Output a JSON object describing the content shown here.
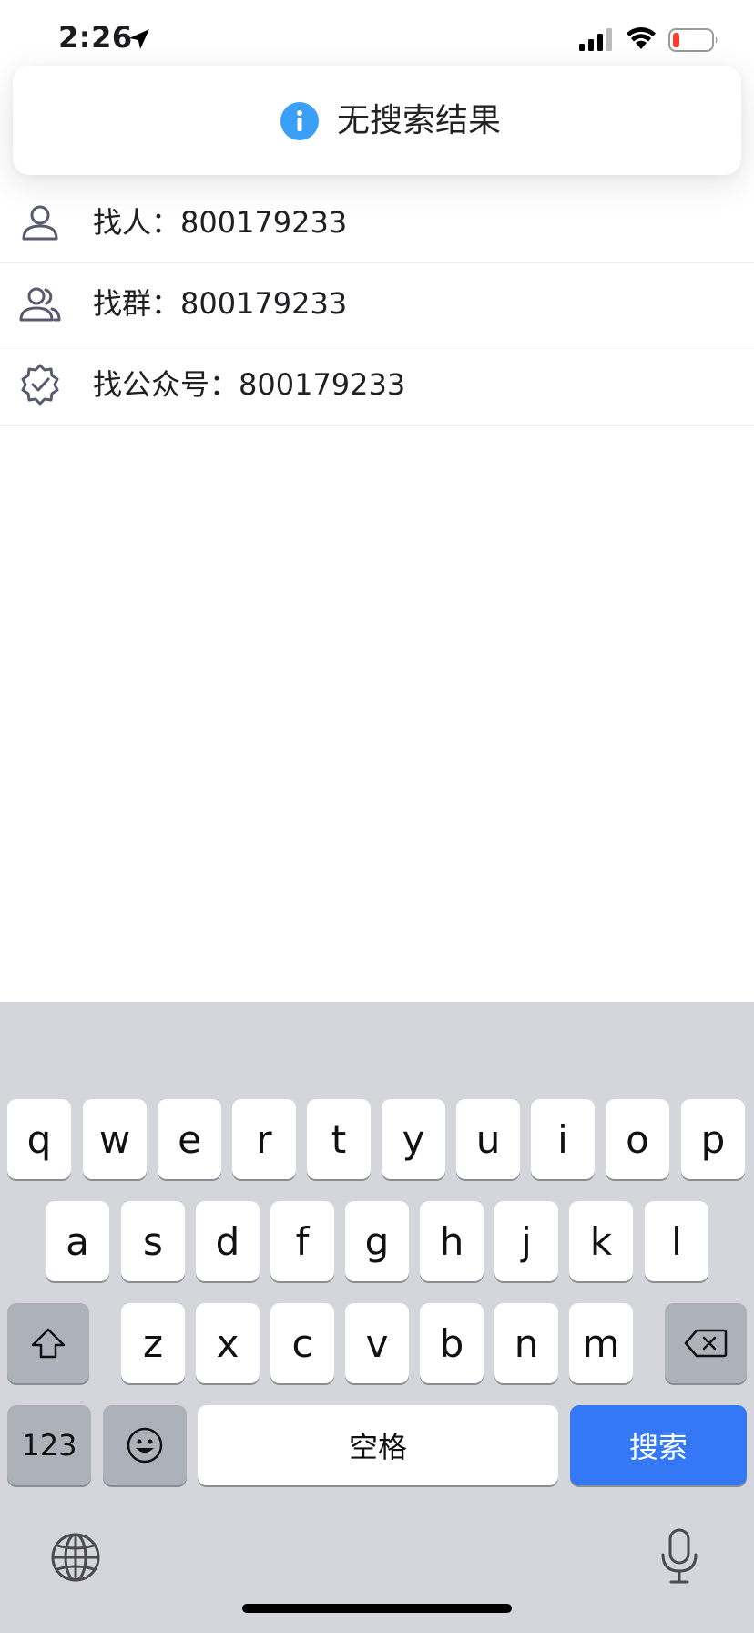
{
  "status_bar": {
    "time": "2:26"
  },
  "toast": {
    "message": "无搜索结果",
    "icon": "info-icon",
    "accent_color": "#3aa0f7"
  },
  "results": [
    {
      "icon": "user-icon",
      "label": "找人：800179233"
    },
    {
      "icon": "group-icon",
      "label": "找群：800179233"
    },
    {
      "icon": "verified-badge-icon",
      "label": "找公众号：800179233"
    }
  ],
  "keyboard": {
    "row1": [
      "q",
      "w",
      "e",
      "r",
      "t",
      "y",
      "u",
      "i",
      "o",
      "p"
    ],
    "row2": [
      "a",
      "s",
      "d",
      "f",
      "g",
      "h",
      "j",
      "k",
      "l"
    ],
    "row3": [
      "z",
      "x",
      "c",
      "v",
      "b",
      "n",
      "m"
    ],
    "numbers_label": "123",
    "space_label": "空格",
    "search_label": "搜索",
    "search_color": "#3478f6"
  }
}
